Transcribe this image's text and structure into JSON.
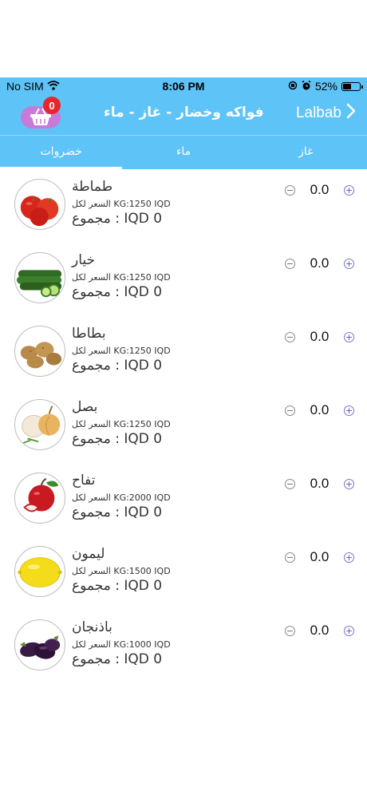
{
  "status_bar": {
    "carrier": "No SIM",
    "time": "8:06 PM",
    "battery": "52%",
    "battery_level": 0.52
  },
  "nav": {
    "title": "فواكه وخضار - غاز - ماء",
    "back_label": "Lalbab",
    "cart_count": "0"
  },
  "tabs": [
    {
      "label": "خضروات",
      "active": true
    },
    {
      "label": "ماء",
      "active": false
    },
    {
      "label": "غاز",
      "active": false
    }
  ],
  "products": [
    {
      "name": "طماطة",
      "price": "السعر لكل KG:1250 IQD",
      "total": "مجموع : IQD 0",
      "quantity": "0.0",
      "icon": "tomato-icon"
    },
    {
      "name": "خيار",
      "price": "السعر لكل KG:1250 IQD",
      "total": "مجموع : IQD 0",
      "quantity": "0.0",
      "icon": "cucumber-icon"
    },
    {
      "name": "بطاطا",
      "price": "السعر لكل KG:1250 IQD",
      "total": "مجموع : IQD 0",
      "quantity": "0.0",
      "icon": "potato-icon"
    },
    {
      "name": "بصل",
      "price": "السعر لكل KG:1250 IQD",
      "total": "مجموع : IQD 0",
      "quantity": "0.0",
      "icon": "onion-icon"
    },
    {
      "name": "تفاح",
      "price": "السعر لكل KG:2000 IQD",
      "total": "مجموع : IQD 0",
      "quantity": "0.0",
      "icon": "apple-icon"
    },
    {
      "name": "ليمون",
      "price": "السعر لكل KG:1500 IQD",
      "total": "مجموع : IQD 0",
      "quantity": "0.0",
      "icon": "lemon-icon"
    },
    {
      "name": "باذنجان",
      "price": "السعر لكل KG:1000 IQD",
      "total": "مجموع : IQD 0",
      "quantity": "0.0",
      "icon": "eggplant-icon"
    }
  ],
  "colors": {
    "header": "#5ec3f7",
    "badge": "#e5262c",
    "cart": "#c77bd8"
  }
}
